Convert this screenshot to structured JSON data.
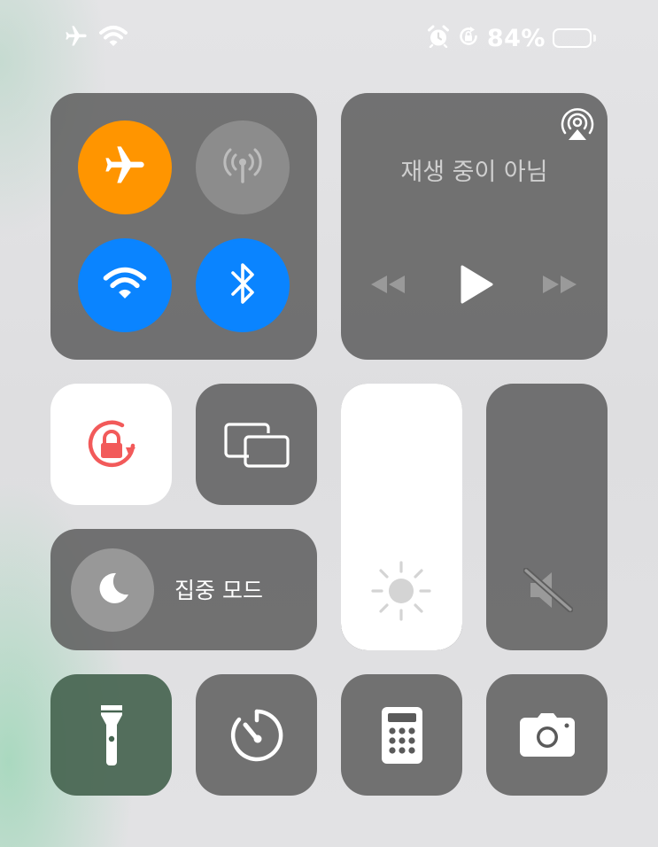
{
  "status_bar": {
    "left_icons": [
      "airplane-icon",
      "wifi-icon"
    ],
    "right_icons": [
      "alarm-icon",
      "orientation-lock-icon"
    ],
    "battery_percent": 84,
    "battery_text": "84%"
  },
  "connectivity": {
    "airplane": {
      "icon": "airplane-icon",
      "on": true,
      "color": "#FF9500"
    },
    "cellular": {
      "icon": "cellular-antenna-icon",
      "on": false
    },
    "wifi": {
      "icon": "wifi-icon",
      "on": true,
      "color": "#0A84FF"
    },
    "bluetooth": {
      "icon": "bluetooth-icon",
      "on": true,
      "color": "#0A84FF"
    }
  },
  "media": {
    "title": "재생 중이 아님",
    "airplay_icon": "airplay-icon",
    "controls": [
      "rewind-icon",
      "play-icon",
      "fast-forward-icon"
    ]
  },
  "orientation_lock": {
    "icon": "orientation-lock-icon",
    "on": true,
    "accent": "#F25A5A"
  },
  "screen_mirroring": {
    "icon": "screen-mirroring-icon"
  },
  "focus": {
    "label": "집중 모드",
    "icon": "moon-icon"
  },
  "brightness": {
    "icon": "sun-icon",
    "level": 1.0
  },
  "volume": {
    "icon": "speaker-muted-icon",
    "level": 0.0
  },
  "bottom_row": [
    {
      "name": "flashlight",
      "icon": "flashlight-icon"
    },
    {
      "name": "timer",
      "icon": "timer-icon"
    },
    {
      "name": "calculator",
      "icon": "calculator-icon"
    },
    {
      "name": "camera",
      "icon": "camera-icon"
    }
  ]
}
